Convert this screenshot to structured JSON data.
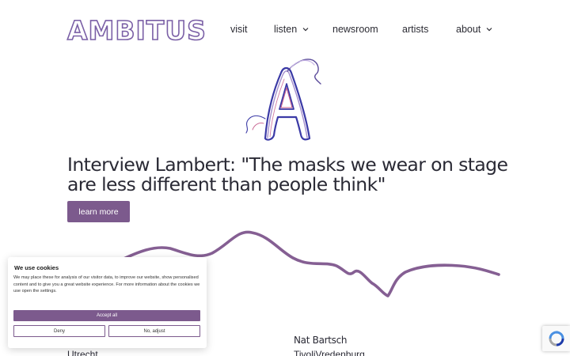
{
  "brand": {
    "logo_text": "AMBITUS",
    "accent_color": "#7c5a8d"
  },
  "nav": {
    "items": [
      {
        "label": "visit",
        "has_dropdown": false
      },
      {
        "label": "listen",
        "has_dropdown": true
      },
      {
        "label": "newsroom",
        "has_dropdown": false
      },
      {
        "label": "artists",
        "has_dropdown": false
      },
      {
        "label": "about",
        "has_dropdown": true
      }
    ]
  },
  "hero": {
    "headline": "Interview Lambert: \"The masks we wear on stage are less different than people think\"",
    "button_label": "learn more"
  },
  "venues": {
    "left_city": "Utrecht",
    "right_name": "Nat Bartsch",
    "right_venue": "TivoliVredenburg"
  },
  "cookie_banner": {
    "title": "We use cookies",
    "body": "We may place these for analysis of our visitor data, to improve our website, show personalised content and to give you a great website experience. For more information about the cookies we use open the settings.",
    "accept_label": "Accept all",
    "deny_label": "Deny",
    "adjust_label": "No, adjust"
  },
  "icons": {
    "chevron": "chevron-down-icon",
    "recaptcha": "recaptcha-icon"
  }
}
